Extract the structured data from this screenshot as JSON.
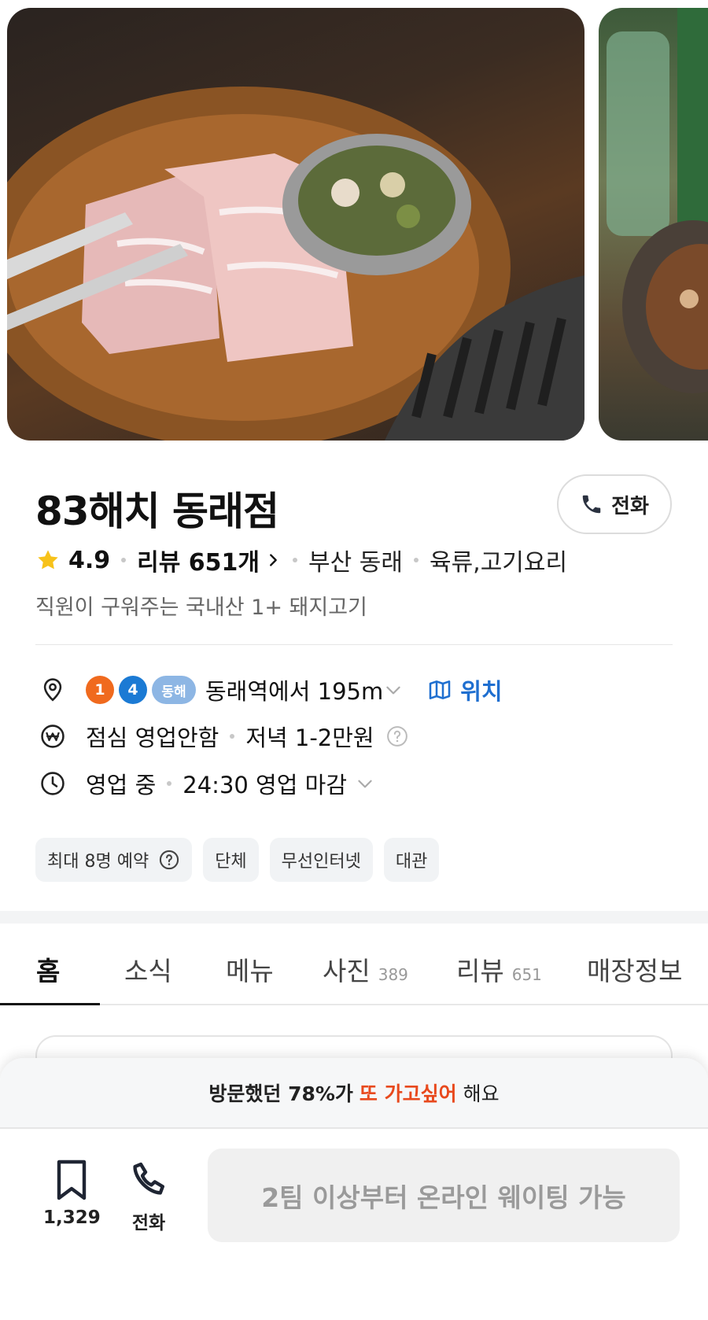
{
  "store": {
    "name": "83해치 동래점",
    "rating": "4.9",
    "reviews_label": "리뷰 651개",
    "region": "부산 동래",
    "category": "육류,고기요리",
    "description": "직원이 구워주는 국내산 1+ 돼지고기"
  },
  "call_button": {
    "label": "전화",
    "icon": "phone-icon"
  },
  "location": {
    "lines": [
      "1",
      "4",
      "동해"
    ],
    "distance": "동래역에서 195m",
    "link_label": "위치",
    "icon": "map-pin-icon"
  },
  "price": {
    "lunch": "점심 영업안함",
    "dinner": "저녁 1-2만원",
    "icon": "won-icon"
  },
  "hours": {
    "status": "영업 중",
    "close": "24:30 영업 마감",
    "icon": "clock-icon"
  },
  "tags": [
    {
      "label": "최대 8명 예약",
      "help": true
    },
    {
      "label": "단체"
    },
    {
      "label": "무선인터넷"
    },
    {
      "label": "대관"
    }
  ],
  "tabs": [
    {
      "label": "홈",
      "count": ""
    },
    {
      "label": "소식",
      "count": ""
    },
    {
      "label": "메뉴",
      "count": ""
    },
    {
      "label": "사진",
      "count": "389"
    },
    {
      "label": "리뷰",
      "count": "651"
    },
    {
      "label": "매장정보",
      "count": ""
    }
  ],
  "active_tab": "홈",
  "bottom_sheet": {
    "banner_pre": "방문했던 78%가",
    "banner_accent": "또 가고싶어",
    "banner_post": "해요",
    "save_count": "1,329",
    "phone_label": "전화",
    "waiting_label": "2팀 이상부터 온라인 웨이팅 가능"
  },
  "colors": {
    "accent_orange": "#e8491d",
    "link_blue": "#1f6fd0",
    "star_yellow": "#f7c21a",
    "line_1": "#f06a1e",
    "line_4": "#1b7ad4",
    "line_donghae": "#8db6e4"
  }
}
